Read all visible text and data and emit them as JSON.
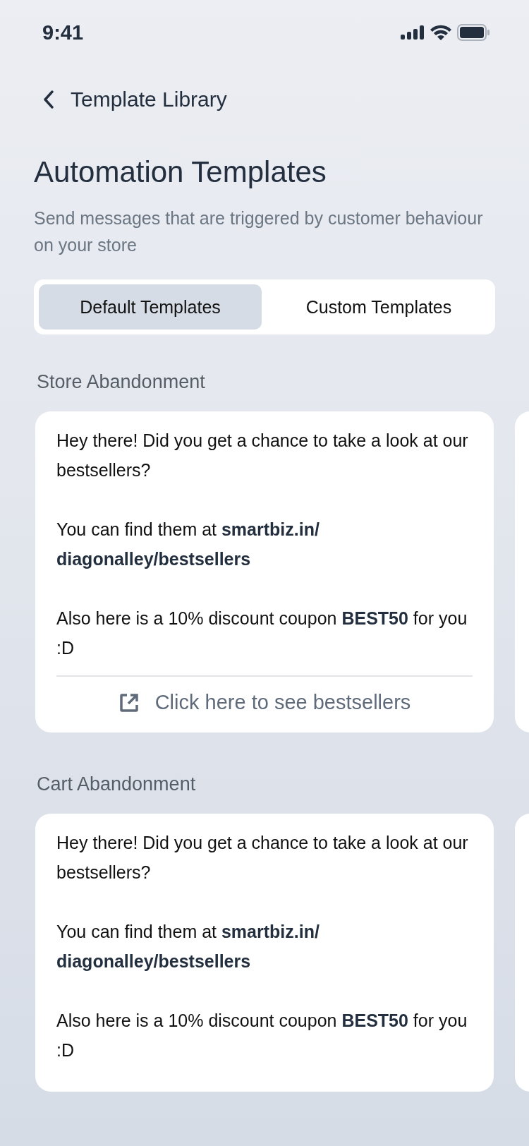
{
  "status_bar": {
    "time": "9:41"
  },
  "nav": {
    "back_label": "Template Library"
  },
  "header": {
    "title": "Automation Templates",
    "subtitle": "Send messages that are triggered by customer behaviour on your store"
  },
  "tabs": [
    {
      "label": "Default Templates",
      "selected": true
    },
    {
      "label": "Custom Templates",
      "selected": false
    }
  ],
  "sections": [
    {
      "title": "Store Abandonment",
      "card": {
        "paragraphs": [
          "Hey there! Did you get a chance to take a look at our bestsellers?",
          "You can find them at **smartbiz.in/ diagonalley/bestsellers**",
          "Also here is a 10% discount coupon **BEST50** for you :D"
        ],
        "link": "Click here to see bestsellers"
      }
    },
    {
      "title": "Cart Abandonment",
      "card": {
        "paragraphs": [
          "Hey there! Did you get a chance to take a look at our bestsellers?",
          "You can find them at **smartbiz.in/ diagonalley/bestsellers**",
          "Also here is a 10% discount coupon **BEST50** for you :D"
        ]
      }
    }
  ]
}
